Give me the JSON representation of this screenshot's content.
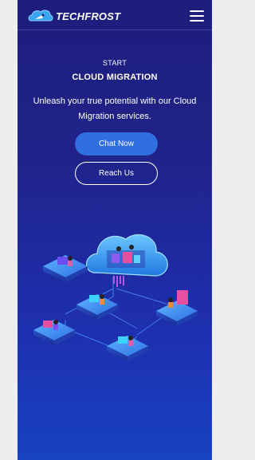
{
  "header": {
    "brand": "TECHFROST",
    "logo_icon": "cloud-rocket-icon",
    "menu_icon": "hamburger-menu-icon"
  },
  "hero": {
    "kicker": "START",
    "title": "CLOUD MIGRATION",
    "subtitle": "Unleash your true potential with our Cloud Migration services.",
    "primary_button": "Chat Now",
    "secondary_button": "Reach Us",
    "illustration_icon": "cloud-network-isometric-illustration"
  },
  "colors": {
    "background_top": "#1d1d7c",
    "background_bottom": "#1742c2",
    "primary_button": "#2f6fe0",
    "cloud": "#3aa0f0"
  }
}
